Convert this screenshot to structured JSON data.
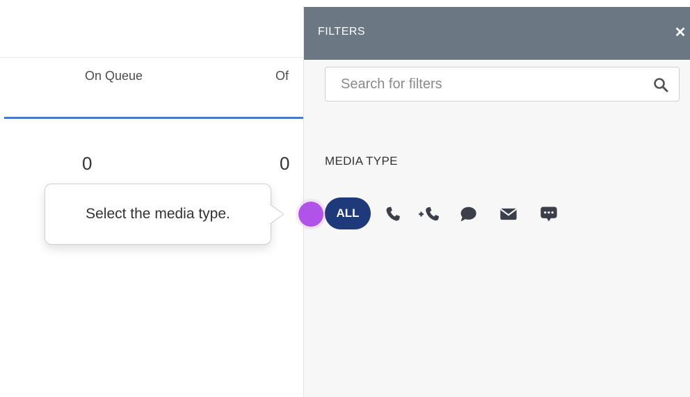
{
  "stats": {
    "columns": [
      {
        "label": "On Queue",
        "value": "0"
      },
      {
        "label": "Of",
        "value": "0"
      }
    ]
  },
  "tooltip": {
    "text": "Select the media type."
  },
  "filters": {
    "title": "FILTERS",
    "close_icon": "close-icon",
    "search": {
      "placeholder": "Search for filters",
      "value": ""
    },
    "media_type": {
      "label": "MEDIA TYPE",
      "selected": "ALL",
      "options": [
        {
          "label": "ALL"
        },
        {
          "icon": "phone-icon"
        },
        {
          "icon": "callback-icon"
        },
        {
          "icon": "chat-icon"
        },
        {
          "icon": "email-icon"
        },
        {
          "icon": "message-icon"
        }
      ]
    }
  },
  "colors": {
    "panel_header": "#6b7883",
    "accent_line": "#4a78c8",
    "all_pill": "#1f3a7a",
    "hotspot": "#b153e8"
  }
}
